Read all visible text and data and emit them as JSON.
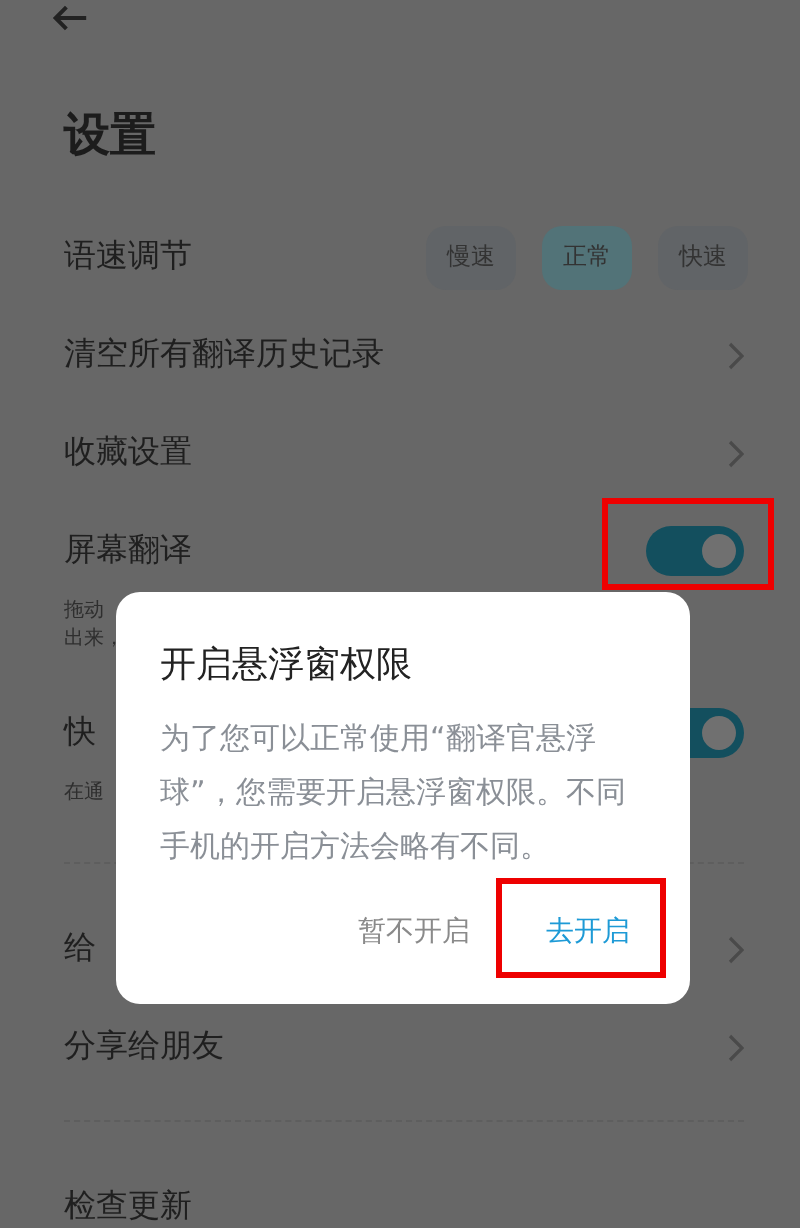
{
  "page": {
    "title": "设置"
  },
  "settings": [
    {
      "kind": "speed",
      "label": "语速调节",
      "options": [
        {
          "label": "慢速",
          "selected": false
        },
        {
          "label": "正常",
          "selected": true
        },
        {
          "label": "快速",
          "selected": false
        }
      ]
    },
    {
      "kind": "link",
      "label": "清空所有翻译历史记录"
    },
    {
      "kind": "link",
      "label": "收藏设置"
    },
    {
      "kind": "toggle",
      "label": "屏幕翻译",
      "on": true,
      "highlighted": true,
      "hint": [
        "拖动",
        "出来，"
      ]
    },
    {
      "kind": "toggle",
      "label": "快",
      "on": true,
      "hint": [
        "在通"
      ],
      "divider": true
    },
    {
      "kind": "link",
      "label": "给"
    },
    {
      "kind": "link",
      "label": "分享给朋友",
      "divider": true
    },
    {
      "kind": "plain",
      "label": "检查更新"
    }
  ],
  "dialog": {
    "title": "开启悬浮窗权限",
    "message": "为了您可以正常使用“翻译官悬浮球”，您需要开启悬浮窗权限。不同手机的开启方法会略有不同。",
    "buttons": [
      {
        "label": "暂不开启",
        "kind": "cancel",
        "highlighted": false
      },
      {
        "label": "去开启",
        "kind": "confirm",
        "highlighted": true
      }
    ]
  }
}
